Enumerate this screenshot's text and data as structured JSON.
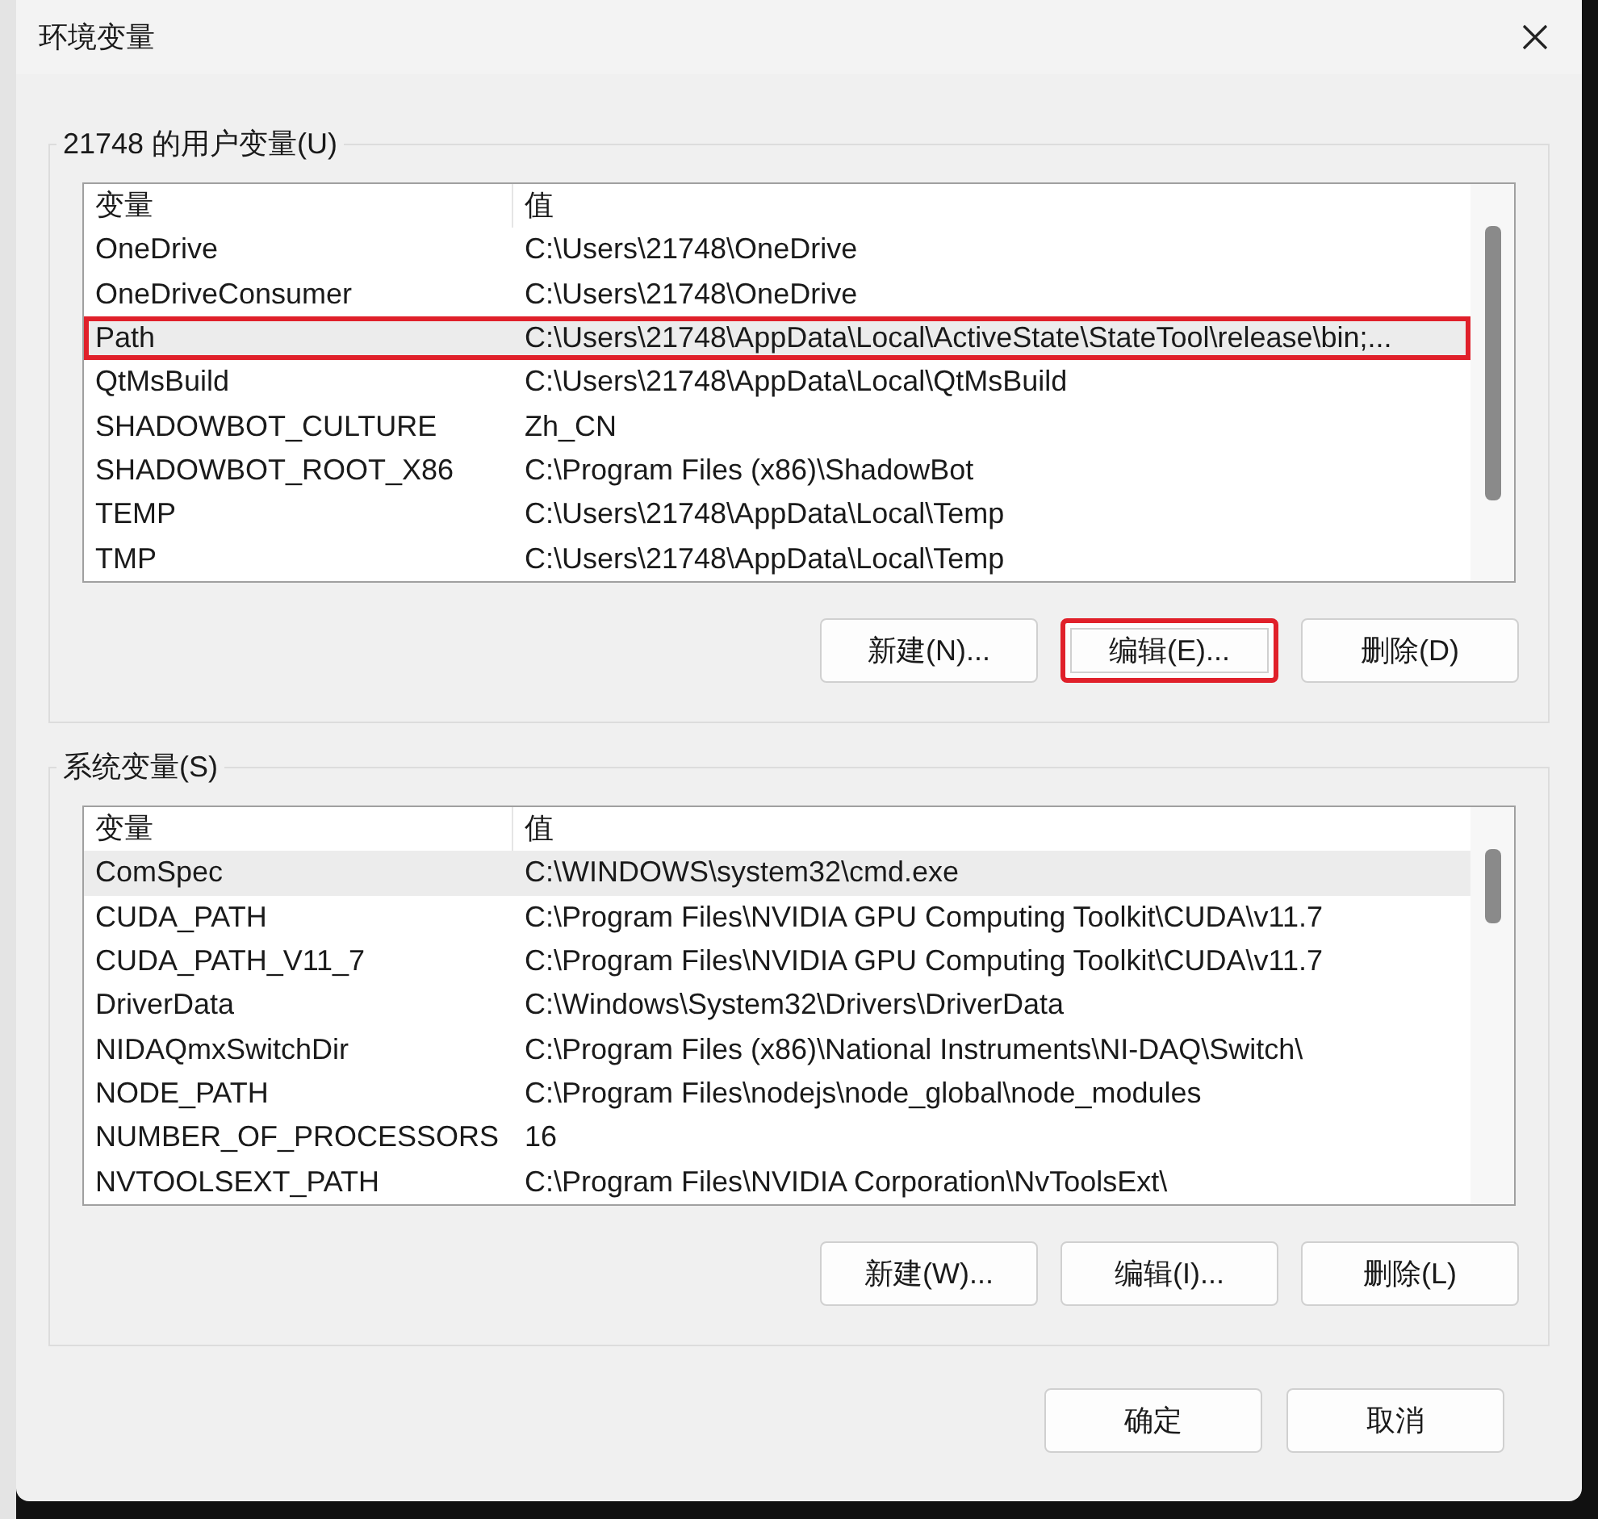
{
  "window": {
    "title": "环境变量"
  },
  "user_variables": {
    "label": "21748 的用户变量(U)",
    "columns": [
      "变量",
      "值"
    ],
    "rows": [
      {
        "name": "OneDrive",
        "value": "C:\\Users\\21748\\OneDrive",
        "selected": false,
        "highlighted": false
      },
      {
        "name": "OneDriveConsumer",
        "value": "C:\\Users\\21748\\OneDrive",
        "selected": false,
        "highlighted": false
      },
      {
        "name": "Path",
        "value": "C:\\Users\\21748\\AppData\\Local\\ActiveState\\StateTool\\release\\bin;...",
        "selected": true,
        "highlighted": true
      },
      {
        "name": "QtMsBuild",
        "value": "C:\\Users\\21748\\AppData\\Local\\QtMsBuild",
        "selected": false,
        "highlighted": false
      },
      {
        "name": "SHADOWBOT_CULTURE",
        "value": "Zh_CN",
        "selected": false,
        "highlighted": false
      },
      {
        "name": "SHADOWBOT_ROOT_X86",
        "value": "C:\\Program Files (x86)\\ShadowBot",
        "selected": false,
        "highlighted": false
      },
      {
        "name": "TEMP",
        "value": "C:\\Users\\21748\\AppData\\Local\\Temp",
        "selected": false,
        "highlighted": false
      },
      {
        "name": "TMP",
        "value": "C:\\Users\\21748\\AppData\\Local\\Temp",
        "selected": false,
        "highlighted": false
      }
    ],
    "buttons": [
      {
        "label": "新建(N)...",
        "highlighted": false
      },
      {
        "label": "编辑(E)...",
        "highlighted": true
      },
      {
        "label": "删除(D)",
        "highlighted": false
      }
    ]
  },
  "system_variables": {
    "label": "系统变量(S)",
    "columns": [
      "变量",
      "值"
    ],
    "rows": [
      {
        "name": "ComSpec",
        "value": "C:\\WINDOWS\\system32\\cmd.exe",
        "selected": true,
        "highlighted": false
      },
      {
        "name": "CUDA_PATH",
        "value": "C:\\Program Files\\NVIDIA GPU Computing Toolkit\\CUDA\\v11.7",
        "selected": false,
        "highlighted": false
      },
      {
        "name": "CUDA_PATH_V11_7",
        "value": "C:\\Program Files\\NVIDIA GPU Computing Toolkit\\CUDA\\v11.7",
        "selected": false,
        "highlighted": false
      },
      {
        "name": "DriverData",
        "value": "C:\\Windows\\System32\\Drivers\\DriverData",
        "selected": false,
        "highlighted": false
      },
      {
        "name": "NIDAQmxSwitchDir",
        "value": "C:\\Program Files (x86)\\National Instruments\\NI-DAQ\\Switch\\",
        "selected": false,
        "highlighted": false
      },
      {
        "name": "NODE_PATH",
        "value": "C:\\Program Files\\nodejs\\node_global\\node_modules",
        "selected": false,
        "highlighted": false
      },
      {
        "name": "NUMBER_OF_PROCESSORS",
        "value": "16",
        "selected": false,
        "highlighted": false
      },
      {
        "name": "NVTOOLSEXT_PATH",
        "value": "C:\\Program Files\\NVIDIA Corporation\\NvToolsExt\\",
        "selected": false,
        "highlighted": false
      }
    ],
    "buttons": [
      {
        "label": "新建(W)...",
        "highlighted": false
      },
      {
        "label": "编辑(I)...",
        "highlighted": false
      },
      {
        "label": "删除(L)",
        "highlighted": false
      }
    ]
  },
  "dialog_buttons": [
    "确定",
    "取消"
  ]
}
